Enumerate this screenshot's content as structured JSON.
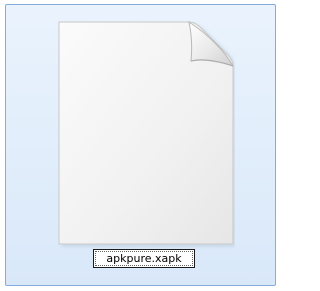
{
  "file": {
    "name": "apkpure.xapk",
    "icon": "blank-document-icon",
    "state": "selected-renaming"
  },
  "colors": {
    "selection_border": "#84acdd",
    "selection_fill": "#dce9f8",
    "page_fill": "#f7f7f7"
  }
}
